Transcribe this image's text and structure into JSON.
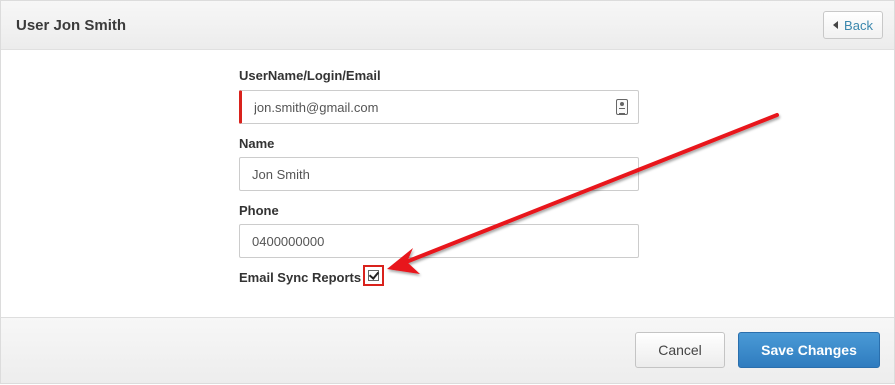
{
  "header": {
    "title": "User Jon Smith",
    "back_label": "Back"
  },
  "form": {
    "username_label": "UserName/Login/Email",
    "username_value": "jon.smith@gmail.com",
    "name_label": "Name",
    "name_value": "Jon Smith",
    "phone_label": "Phone",
    "phone_value": "0400000000",
    "email_sync_label": "Email Sync Reports",
    "email_sync_checked": true
  },
  "footer": {
    "cancel_label": "Cancel",
    "save_label": "Save Changes"
  },
  "icons": {
    "back": "caret-left-icon",
    "contact_card": "contact-card-icon",
    "checkmark": "checkmark-icon"
  },
  "colors": {
    "accent_blue": "#2f7cbf",
    "link_blue": "#3a87ad",
    "annotation_red": "#d9221c"
  }
}
